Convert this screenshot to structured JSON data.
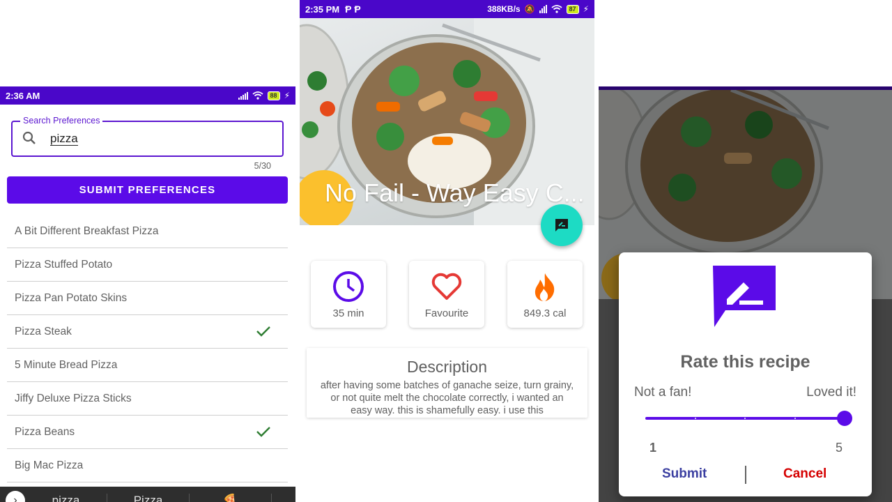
{
  "screen1": {
    "status": {
      "time": "2:36 AM",
      "battery": "88"
    },
    "search": {
      "label": "Search Preferences",
      "value": "pizza",
      "counter": "5/30"
    },
    "submit_label": "SUBMIT PREFERENCES",
    "recipes": [
      {
        "name": "A Bit Different  Breakfast Pizza",
        "checked": false
      },
      {
        "name": "Pizza  Stuffed Potato",
        "checked": false
      },
      {
        "name": "Pizza Pan  Potato Skins",
        "checked": false
      },
      {
        "name": "Pizza  Steak",
        "checked": true
      },
      {
        "name": "5 Minute Bread  Pizza",
        "checked": false
      },
      {
        "name": "Jiffy  Deluxe Pizza Sticks",
        "checked": false
      },
      {
        "name": "Pizza  Beans",
        "checked": true
      },
      {
        "name": "Big Mac  Pizza",
        "checked": false
      }
    ],
    "keyboard_suggestions": [
      "pizza",
      "Pizza"
    ]
  },
  "screen2": {
    "status": {
      "time": "2:35 PM",
      "speed": "388KB/s",
      "battery": "87"
    },
    "recipe_title": "No Fail - Way Easy C...",
    "stats": {
      "time": "35 min",
      "favourite": "Favourite",
      "calories": "849.3 cal"
    },
    "description": {
      "title": "Description",
      "text": "after having some batches of ganache seize, turn grainy, or not quite melt the chocolate correctly, i wanted an easy way. this is shamefully easy. i use this"
    },
    "colors": {
      "accent": "#5b0be8",
      "fab": "#1ddbc4",
      "heart": "#e53935",
      "flame": "#ff6d00"
    }
  },
  "screen3": {
    "dialog": {
      "title": "Rate this recipe",
      "min_label": "Not a fan!",
      "max_label": "Loved it!",
      "min_value": "1",
      "max_value": "5",
      "rating": 5,
      "submit_label": "Submit",
      "cancel_label": "Cancel"
    }
  }
}
